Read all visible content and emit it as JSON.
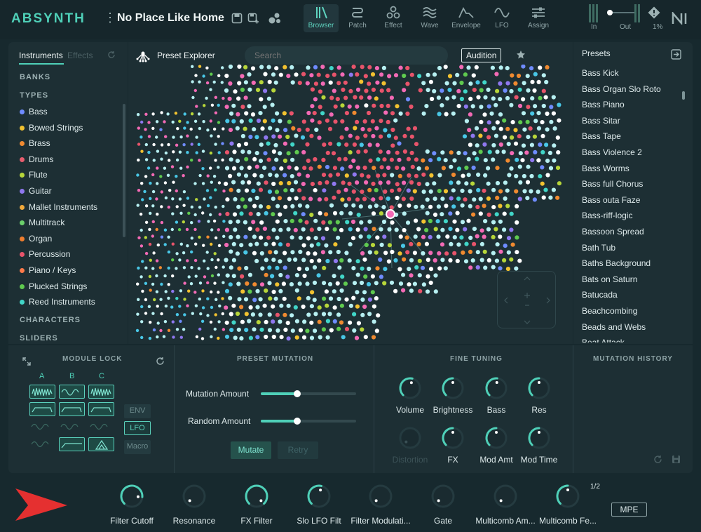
{
  "header": {
    "logo": "ABSYNTH",
    "preset_name": "No Place Like Home",
    "nav_tabs": [
      {
        "label": "Browser",
        "icon": "browser-icon",
        "active": true
      },
      {
        "label": "Patch",
        "icon": "patch-icon",
        "active": false
      },
      {
        "label": "Effect",
        "icon": "effect-icon",
        "active": false
      },
      {
        "label": "Wave",
        "icon": "wave-icon",
        "active": false
      },
      {
        "label": "Envelope",
        "icon": "envelope-icon",
        "active": false
      },
      {
        "label": "LFO",
        "icon": "lfo-icon",
        "active": false
      },
      {
        "label": "Assign",
        "icon": "assign-icon",
        "active": false
      }
    ],
    "in_label": "In",
    "out_label": "Out",
    "cpu_label": "1%"
  },
  "left_panel": {
    "tabs": [
      "Instruments",
      "Effects"
    ],
    "banks": "BANKS",
    "types": "TYPES",
    "type_items": [
      {
        "label": "Bass",
        "color": "#6f8cff"
      },
      {
        "label": "Bowed Strings",
        "color": "#f2c230"
      },
      {
        "label": "Brass",
        "color": "#f08a30"
      },
      {
        "label": "Drums",
        "color": "#e85d6e"
      },
      {
        "label": "Flute",
        "color": "#b7d63a"
      },
      {
        "label": "Guitar",
        "color": "#8f78f0"
      },
      {
        "label": "Mallet Instruments",
        "color": "#f1a93b"
      },
      {
        "label": "Multitrack",
        "color": "#6bd06b"
      },
      {
        "label": "Organ",
        "color": "#f07e2e"
      },
      {
        "label": "Percussion",
        "color": "#e8546b"
      },
      {
        "label": "Piano / Keys",
        "color": "#ff7a4a"
      },
      {
        "label": "Plucked Strings",
        "color": "#5fca4f"
      },
      {
        "label": "Reed Instruments",
        "color": "#41d6c8"
      }
    ],
    "characters": "CHARACTERS",
    "sliders": "SLIDERS"
  },
  "explorer": {
    "title": "Preset Explorer",
    "search_placeholder": "Search",
    "audition": "Audition",
    "dot_colors": [
      "#e8546b",
      "#f36ab5",
      "#ffffff",
      "#b7f0f2",
      "#49c7e6",
      "#6f8cff",
      "#5fca4f",
      "#f2c230",
      "#b7d63a",
      "#8f78f0",
      "#f08a30",
      "#41d6c8"
    ]
  },
  "presets": {
    "title": "Presets",
    "items": [
      "Bass Kick",
      "Bass Organ Slo Roto",
      "Bass Piano",
      "Bass Sitar",
      "Bass Tape",
      "Bass Violence 2",
      "Bass Worms",
      "Bass full Chorus",
      "Bass outa Faze",
      "Bass-riff-logic",
      "Bassoon Spread",
      "Bath Tub",
      "Baths Background",
      "Bats on Saturn",
      "Batucada",
      "Beachcombing",
      "Beads and Webs",
      "Beat Attack"
    ]
  },
  "module_lock": {
    "title": "MODULE LOCK",
    "cols": [
      "A",
      "B",
      "C"
    ],
    "env": "ENV",
    "lfo": "LFO",
    "macro": "Macro"
  },
  "preset_mutation": {
    "title": "PRESET MUTATION",
    "mutation_amount_label": "Mutation Amount",
    "mutation_amount": 0.38,
    "random_amount_label": "Random Amount",
    "random_amount": 0.38,
    "mutate": "Mutate",
    "retry": "Retry"
  },
  "fine_tuning": {
    "title": "FINE TUNING",
    "knobs": [
      {
        "label": "Volume",
        "value": 0.55,
        "enabled": true
      },
      {
        "label": "Brightness",
        "value": 0.5,
        "enabled": true
      },
      {
        "label": "Bass",
        "value": 0.52,
        "enabled": true
      },
      {
        "label": "Res",
        "value": 0.5,
        "enabled": true
      },
      {
        "label": "Distortion",
        "value": 0.0,
        "enabled": false
      },
      {
        "label": "FX",
        "value": 0.5,
        "enabled": true
      },
      {
        "label": "Mod Amt",
        "value": 0.5,
        "enabled": true
      },
      {
        "label": "Mod Time",
        "value": 0.5,
        "enabled": true
      }
    ]
  },
  "mutation_history": {
    "title": "MUTATION HISTORY"
  },
  "footer": {
    "page": "1/2",
    "mpe": "MPE",
    "knobs": [
      {
        "label": "Filter Cutoff",
        "value": 0.85
      },
      {
        "label": "Resonance",
        "value": 0.0
      },
      {
        "label": "FX Filter",
        "value": 1.0
      },
      {
        "label": "Slo LFO Filt",
        "value": 0.55
      },
      {
        "label": "Filter Modulati...",
        "value": 0.0
      },
      {
        "label": "Gate",
        "value": 0.0
      },
      {
        "label": "Multicomb Am...",
        "value": 0.0
      },
      {
        "label": "Multicomb Fe...",
        "value": 0.5
      }
    ]
  }
}
